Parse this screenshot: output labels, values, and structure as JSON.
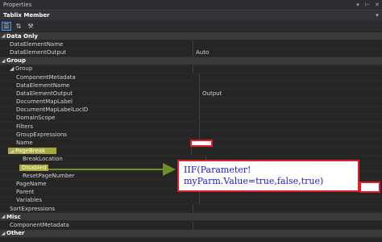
{
  "window": {
    "title": "Properties",
    "pin_icon": "pin-icon",
    "close_icon": "close-icon"
  },
  "object": {
    "name": "Tablix Member",
    "dropdown_icon": "chevron-down-icon"
  },
  "toolbar": {
    "categorized_icon": "categorized-icon",
    "alphabetical_icon": "alphabetical-icon",
    "property_pages_icon": "wrench-icon"
  },
  "properties": {
    "data_only": {
      "label": "Data Only",
      "dataelementname": "DataElementName",
      "dataelementoutput": "DataElementOutput",
      "dataelementoutput_value": "Auto"
    },
    "group_cat": {
      "label": "Group"
    },
    "group": {
      "label": "Group",
      "componentmetadata": "ComponentMetadata",
      "dataelementname": "DataElementName",
      "dataelementoutput": "DataElementOutput",
      "dataelementoutput_value": "Output",
      "documentmaplabel": "DocumentMapLabel",
      "documentmaplabellocid": "DocumentMapLabelLocID",
      "domainscope": "DomainScope",
      "filters": "Filters",
      "groupexpressions": "GroupExpressions",
      "name": "Name",
      "pagebreak": "PageBreak",
      "breaklocation": "BreakLocation",
      "disabled": "Disabled",
      "resetpagenumber": "ResetPageNumber",
      "pagename": "PageName",
      "parent": "Parent",
      "variables": "Variables",
      "sortexpressions": "SortExpressions"
    },
    "misc": {
      "label": "Misc",
      "componentmetadata": "ComponentMetadata"
    },
    "other": {
      "label": "Other"
    }
  },
  "callout": {
    "line1": "IIF(Parameter!",
    "line2": "myParm.Value=true,false,true)"
  }
}
